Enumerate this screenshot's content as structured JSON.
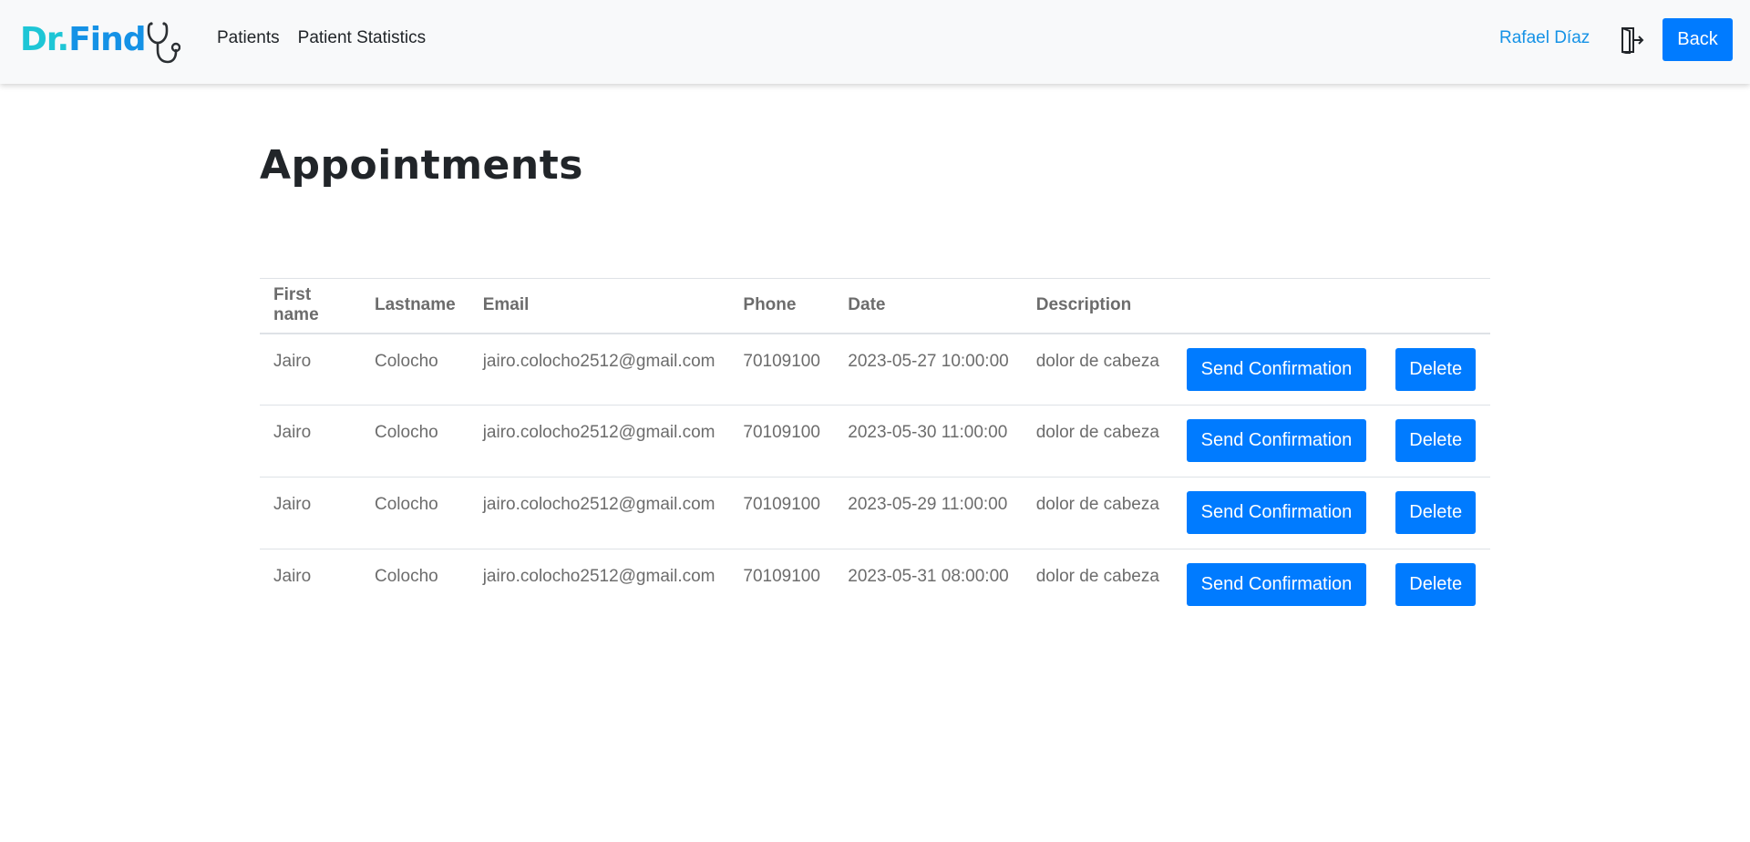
{
  "navbar": {
    "brand_dr": "Dr.",
    "brand_find": "Find",
    "links": [
      "Patients",
      "Patient Statistics"
    ],
    "user_name": "Rafael Díaz",
    "back_label": "Back"
  },
  "main": {
    "title": "Appointments",
    "table": {
      "headers": [
        "First name",
        "Lastname",
        "Email",
        "Phone",
        "Date",
        "Description"
      ],
      "rows": [
        {
          "first_name": "Jairo",
          "last_name": "Colocho",
          "email": "jairo.colocho2512@gmail.com",
          "phone": "70109100",
          "date": "2023-05-27 10:00:00",
          "description": "dolor de cabeza"
        },
        {
          "first_name": "Jairo",
          "last_name": "Colocho",
          "email": "jairo.colocho2512@gmail.com",
          "phone": "70109100",
          "date": "2023-05-30 11:00:00",
          "description": "dolor de cabeza"
        },
        {
          "first_name": "Jairo",
          "last_name": "Colocho",
          "email": "jairo.colocho2512@gmail.com",
          "phone": "70109100",
          "date": "2023-05-29 11:00:00",
          "description": "dolor de cabeza"
        },
        {
          "first_name": "Jairo",
          "last_name": "Colocho",
          "email": "jairo.colocho2512@gmail.com",
          "phone": "70109100",
          "date": "2023-05-31 08:00:00",
          "description": "dolor de cabeza"
        }
      ],
      "send_label": "Send Confirmation",
      "delete_label": "Delete"
    }
  },
  "colors": {
    "primary": "#007bff",
    "brand_cyan": "#1ec6d6",
    "brand_blue": "#1592e6",
    "navbar_bg": "#f8f9fa"
  },
  "icons": {
    "brand": "stethoscope-icon",
    "logout": "logout-door-icon"
  }
}
